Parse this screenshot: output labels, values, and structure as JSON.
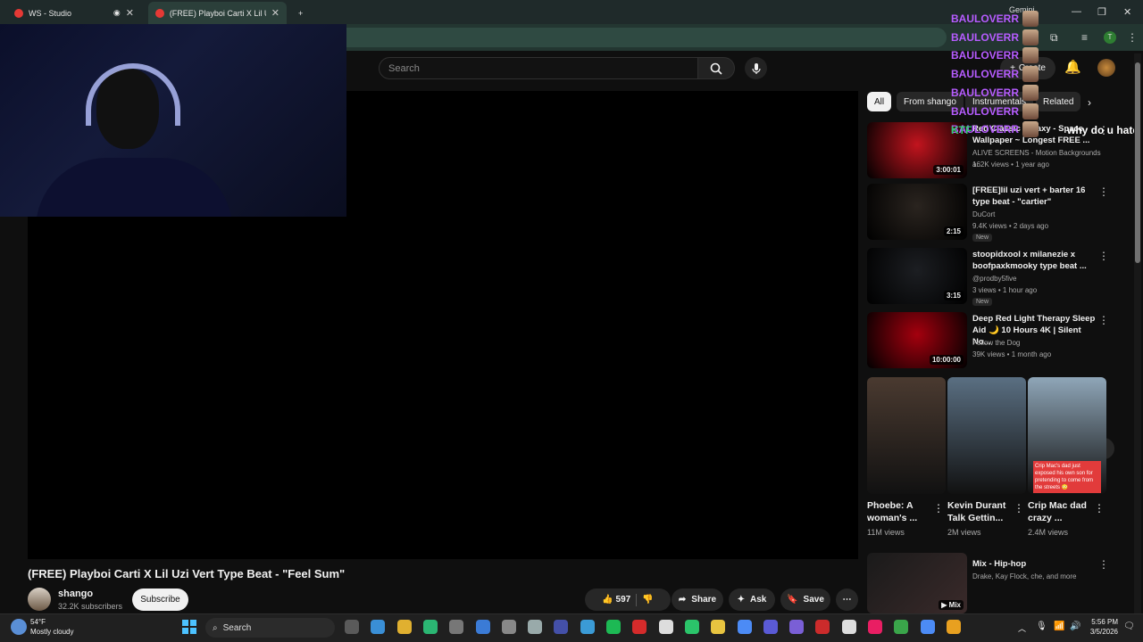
{
  "browser": {
    "tabs": [
      {
        "label": "WS - Studio"
      },
      {
        "label": "(FREE) Playboi Carti X Lil Uzi Ve"
      }
    ],
    "new_tab": "+",
    "profile_initial": "T",
    "gemini_label": "Gemini"
  },
  "youtube": {
    "search_placeholder": "Search",
    "create_label": "Create",
    "video": {
      "title": "(FREE) Playboi Carti X Lil Uzi Vert Type Beat - \"Feel Sum\"",
      "channel_name": "shango",
      "subscribers": "32.2K subscribers",
      "subscribe_label": "Subscribe",
      "likes": "597",
      "share_label": "Share",
      "ask_label": "Ask",
      "save_label": "Save"
    },
    "chips": [
      "All",
      "From shango",
      "Instrumentals",
      "Related"
    ],
    "recommended": [
      {
        "title": "Red Classic Galaxy - Space Wallpaper ~ Longest FREE ...",
        "channel": "ALIVE SCREENS - Motion Backgrounds a...",
        "meta": "162K views • 1 year ago",
        "duration": "3:00:01",
        "new": "",
        "thumb_color": "#c2141e"
      },
      {
        "title": "[FREE]lil uzi vert + barter 16 type beat - \"cartier\"",
        "channel": "DuCort",
        "meta": "9.4K views • 2 days ago",
        "duration": "2:15",
        "new": "New",
        "thumb_color": "#2a241f"
      },
      {
        "title": "stoopidxool x milanezie x boofpaxkmooky type beat ...",
        "channel": "@prodby5five",
        "meta": "3 views • 1 hour ago",
        "duration": "3:15",
        "new": "New",
        "thumb_color": "#1c1e22"
      },
      {
        "title": "Deep Red Light Therapy Sleep Aid 🌙 10 Hours 4K | Silent No...",
        "channel": "Follow the Dog",
        "meta": "39K views • 1 month ago",
        "duration": "10:00:00",
        "new": "",
        "thumb_color": "#a4000e"
      }
    ],
    "shorts": [
      {
        "title": "Phoebe: A woman's ...",
        "views": "11M views",
        "caption": "",
        "thumb_color": "#4a3a30"
      },
      {
        "title": "Kevin Durant Talk Gettin...",
        "views": "2M views",
        "caption": "",
        "thumb_color": "#5a6f82"
      },
      {
        "title": "Crip Mac dad crazy ...",
        "views": "2.4M views",
        "caption": "Crip Mac's dad just exposed his own son for pretending to come from the streets 😳",
        "thumb_color": "#8fa6b8"
      }
    ],
    "mix": {
      "title": "Mix - Hip-hop",
      "meta": "Drake, Kay Flock, che, and more",
      "badge": "Mix"
    }
  },
  "chat_overlay": {
    "lines": [
      "BAULOVERR",
      "BAULOVERR",
      "BAULOVERR",
      "BAULOVERR",
      "BAULOVERR",
      "BAULOVERR",
      "BAULOVERR"
    ],
    "last_line_user": "KTF",
    "last_line_text": "why do u hate m"
  },
  "taskbar": {
    "weather_temp": "54°F",
    "weather_desc": "Mostly cloudy",
    "search_label": "Search",
    "time": "5:56 PM",
    "date": "3/5/2026"
  },
  "colors": {
    "accent": "#ff0000",
    "chat_purple": "#b65cff",
    "chat_green": "#2ecc71"
  }
}
